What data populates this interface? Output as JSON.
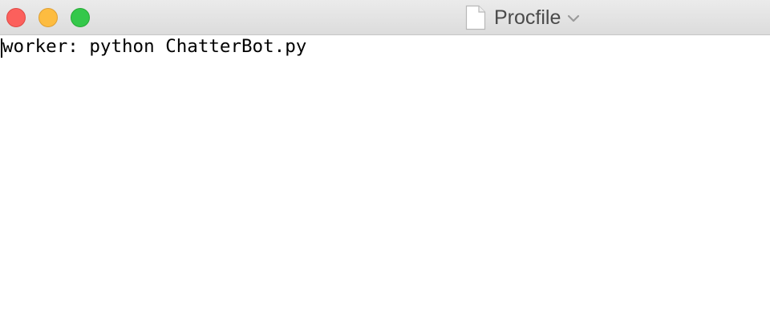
{
  "window": {
    "title": "Procfile"
  },
  "editor": {
    "lines": [
      "worker: python ChatterBot.py"
    ]
  },
  "colors": {
    "close": "#fc605c",
    "minimize": "#fdbc40",
    "maximize": "#34c84a",
    "titlebar": "#e3e3e3",
    "text": "#000000"
  }
}
